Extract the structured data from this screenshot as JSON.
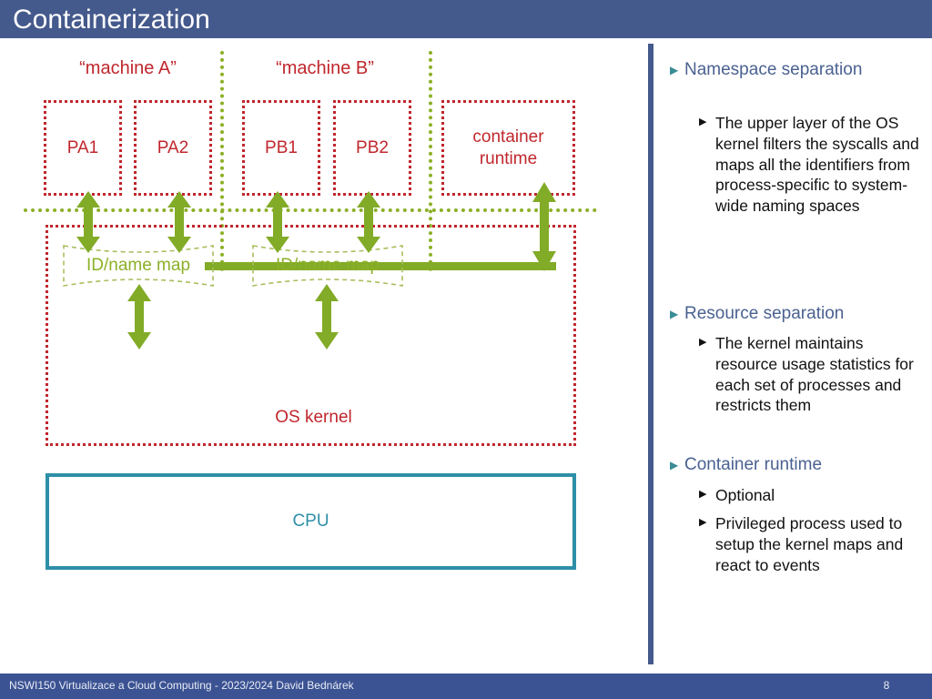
{
  "slide": {
    "title": "Containerization",
    "title_bar_color": "#44598C",
    "footer_text": "NSWI150 Virtualizace a Cloud Computing - 2023/2024 David Bednárek",
    "page_number": "8",
    "footer_bar_color": "#3C5393"
  },
  "diagram": {
    "machine_a_label": "“machine A”",
    "machine_b_label": "“machine B”",
    "processes": [
      {
        "label": "PA1"
      },
      {
        "label": "PA2"
      },
      {
        "label": "PB1"
      },
      {
        "label": "PB2"
      }
    ],
    "container_runtime_label": "container\nruntime",
    "container_runtime_line1": "container",
    "container_runtime_line2": "runtime",
    "id_name_map_a": "ID/name map",
    "id_name_map_b": "ID/name map",
    "os_kernel_label": "OS kernel",
    "cpu_label": "CPU",
    "colors": {
      "process_red": "#C0272D",
      "namespace_green": "#8CB028",
      "arrow_green": "#82AB27",
      "cpu_teal": "#2E8FA8"
    }
  },
  "text_panel": {
    "bullets": [
      {
        "level1": "Namespace separation",
        "children": [
          "The upper layer of the OS kernel filters the syscalls and maps all the identifiers from process-specific to system-wide naming spaces"
        ]
      },
      {
        "level1": "Resource separation",
        "children": [
          "The kernel maintains resource usage statistics for each set of processes and restricts them"
        ]
      },
      {
        "level1": "Container runtime",
        "children": [
          "Optional",
          "Privileged process used to setup the kernel maps and react to events"
        ]
      }
    ],
    "bullet_glyph_level1": "▶",
    "bullet_glyph_level2": "▶",
    "level1_color": "#4A6191",
    "level2_color": "#111111",
    "accent_color": "#3A8C96"
  }
}
